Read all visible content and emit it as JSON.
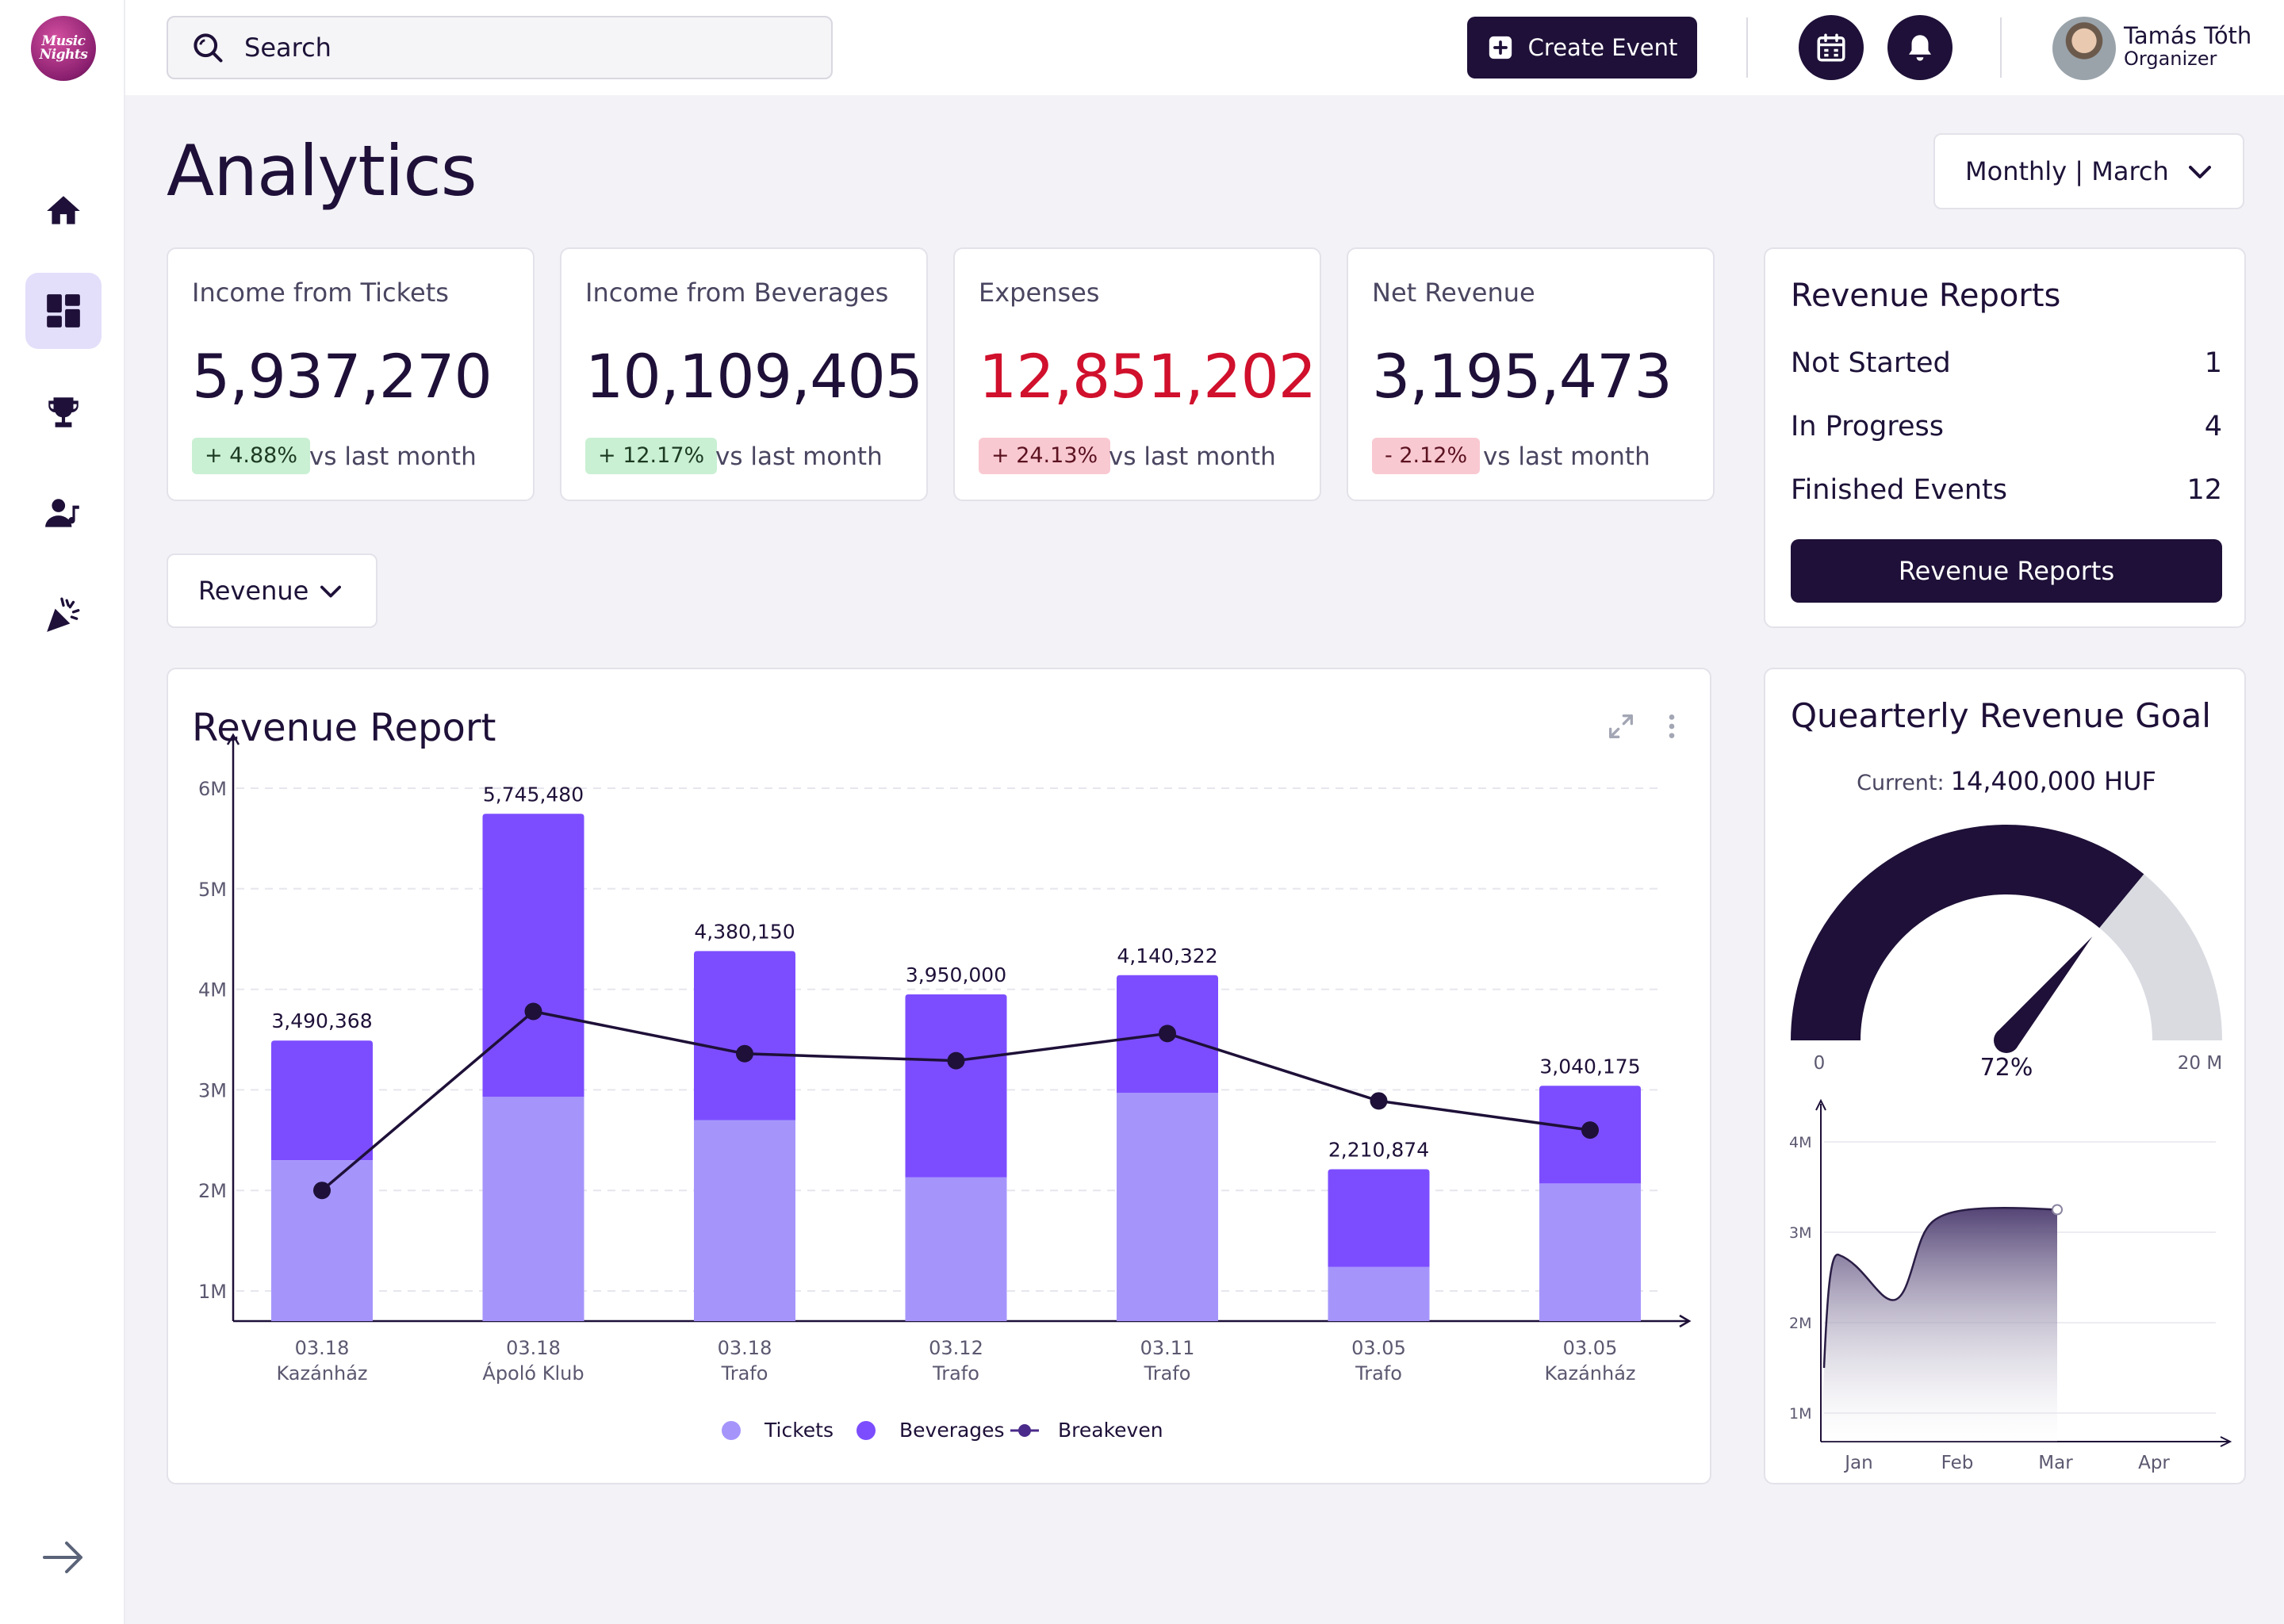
{
  "brand": {
    "logo_text": "Music Nights"
  },
  "sidebar": {
    "items": [
      {
        "name": "home-icon"
      },
      {
        "name": "dashboard-icon",
        "active": true
      },
      {
        "name": "trophy-icon"
      },
      {
        "name": "artist-icon"
      },
      {
        "name": "party-icon"
      }
    ],
    "collapse_icon": "arrow-right-icon"
  },
  "header": {
    "search_placeholder": "Search",
    "create_label": "Create Event",
    "user": {
      "name": "Tamás Tóth",
      "role": "Organizer"
    }
  },
  "page": {
    "title": "Analytics",
    "period": "Monthly | March",
    "metric": "Revenue"
  },
  "kpis": [
    {
      "label": "Income from Tickets",
      "value": "5,937,270",
      "change": "+ 4.88%",
      "trend": "up",
      "vs": "vs last month"
    },
    {
      "label": "Income from Beverages",
      "value": "10,109,405",
      "change": "+ 12.17%",
      "trend": "up",
      "vs": "vs last month"
    },
    {
      "label": "Expenses",
      "value": "12,851,202",
      "change": "+ 24.13%",
      "trend": "down",
      "vs": "vs last month",
      "value_color": "#d0102c"
    },
    {
      "label": "Net Revenue",
      "value": "3,195,473",
      "change": "- 2.12%",
      "trend": "down",
      "vs": "vs last month"
    }
  ],
  "reports": {
    "title": "Revenue Reports",
    "rows": [
      {
        "label": "Not Started",
        "count": "1"
      },
      {
        "label": "In Progress",
        "count": "4"
      },
      {
        "label": "Finished Events",
        "count": "12"
      }
    ],
    "button_label": "Revenue Reports"
  },
  "revenue_report": {
    "title": "Revenue Report"
  },
  "goal": {
    "title": "Quearterly Revenue Goal",
    "current_label": "Current:",
    "current_value": "14,400,000 HUF",
    "min_label": "0",
    "max_label": "20 M",
    "percent_label": "72%"
  },
  "colors": {
    "primary": "#1e1038",
    "tickets": "#a595fb",
    "beverages": "#7c4dff",
    "breakeven": "#1e1038",
    "gauge_track": "#d9dbe1"
  },
  "chart_data": [
    {
      "type": "bar",
      "stacked": true,
      "categories": [
        "03.18 Kazánház",
        "03.18 Ápoló Klub",
        "03.18 Trafo",
        "03.12 Trafo",
        "03.11 Trafo",
        "03.05 Trafo",
        "03.05 Kazánház"
      ],
      "category_lines": [
        [
          "03.18",
          "Kazánház"
        ],
        [
          "03.18",
          "Ápoló Klub"
        ],
        [
          "03.18",
          "Trafo"
        ],
        [
          "03.12",
          "Trafo"
        ],
        [
          "03.11",
          "Trafo"
        ],
        [
          "03.05",
          "Trafo"
        ],
        [
          "03.05",
          "Kazánház"
        ]
      ],
      "series": [
        {
          "name": "Tickets",
          "type": "bar",
          "values": [
            2300000,
            2930000,
            2700000,
            2130000,
            2970000,
            1240000,
            2070000
          ]
        },
        {
          "name": "Beverages",
          "type": "bar",
          "values": [
            1190368,
            2815480,
            1680150,
            1820000,
            1170322,
            970874,
            970175
          ]
        },
        {
          "name": "Breakeven",
          "type": "line",
          "values": [
            2000000,
            3780000,
            3360000,
            3290000,
            3560000,
            2890000,
            2600000
          ]
        }
      ],
      "data_labels": [
        "3,490,368",
        "5,745,480",
        "4,380,150",
        "3,950,000",
        "4,140,322",
        "2,210,874",
        "3,040,175"
      ],
      "y_ticks": [
        "1M",
        "2M",
        "3M",
        "4M",
        "5M",
        "6M"
      ],
      "ylim": [
        0,
        6300000
      ],
      "grid": true,
      "legend": "bottom-center"
    },
    {
      "type": "gauge",
      "value": 0.72,
      "min": 0,
      "max": 20000000
    },
    {
      "type": "area",
      "x_labels": [
        "Jan",
        "Feb",
        "Mar",
        "Apr"
      ],
      "y_ticks": [
        "1M",
        "2M",
        "3M",
        "4M"
      ],
      "ylim": [
        0,
        4300000
      ],
      "points": [
        {
          "x": 0,
          "y": 1500000
        },
        {
          "x": 0.05,
          "y": 2650000
        },
        {
          "x": 0.2,
          "y": 2700000
        },
        {
          "x": 0.6,
          "y": 2250000
        },
        {
          "x": 0.9,
          "y": 2750000
        },
        {
          "x": 1.2,
          "y": 3250000
        },
        {
          "x": 2.0,
          "y": 3250000
        }
      ],
      "grid": true
    }
  ]
}
